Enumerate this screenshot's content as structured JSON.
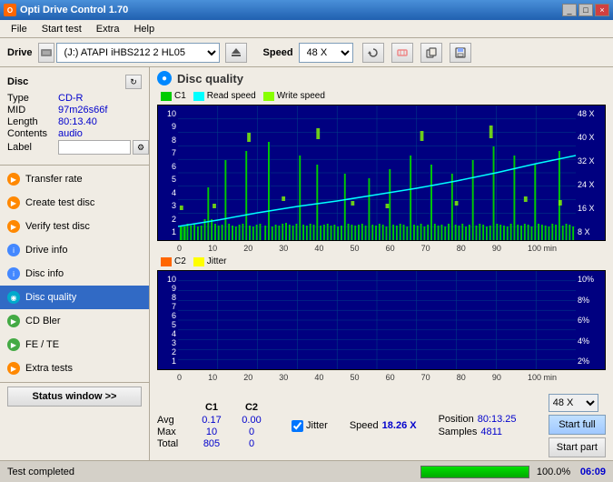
{
  "titlebar": {
    "title": "Opti Drive Control 1.70",
    "icon": "O",
    "buttons": [
      "_",
      "□",
      "×"
    ]
  },
  "menubar": {
    "items": [
      "File",
      "Start test",
      "Extra",
      "Help"
    ]
  },
  "drivebar": {
    "drive_label": "Drive",
    "drive_value": "(J:)  ATAPI iHBS212  2 HL05",
    "speed_label": "Speed",
    "speed_value": "48 X"
  },
  "disc": {
    "title": "Disc",
    "type_label": "Type",
    "type_value": "CD-R",
    "mid_label": "MID",
    "mid_value": "97m26s66f",
    "length_label": "Length",
    "length_value": "80:13.40",
    "contents_label": "Contents",
    "contents_value": "audio",
    "label_label": "Label",
    "label_value": ""
  },
  "sidebar": {
    "items": [
      {
        "id": "transfer-rate",
        "label": "Transfer rate",
        "icon_color": "orange"
      },
      {
        "id": "create-test-disc",
        "label": "Create test disc",
        "icon_color": "orange"
      },
      {
        "id": "verify-test-disc",
        "label": "Verify test disc",
        "icon_color": "orange"
      },
      {
        "id": "drive-info",
        "label": "Drive info",
        "icon_color": "blue"
      },
      {
        "id": "disc-info",
        "label": "Disc info",
        "icon_color": "blue"
      },
      {
        "id": "disc-quality",
        "label": "Disc quality",
        "icon_color": "cyan",
        "active": true
      },
      {
        "id": "cd-bler",
        "label": "CD Bler",
        "icon_color": "green"
      },
      {
        "id": "fe-te",
        "label": "FE / TE",
        "icon_color": "green"
      },
      {
        "id": "extra-tests",
        "label": "Extra tests",
        "icon_color": "orange"
      }
    ],
    "status_btn": "Status window >>"
  },
  "disc_quality": {
    "title": "Disc quality",
    "legend": [
      {
        "label": "C1",
        "color": "#00cc00"
      },
      {
        "label": "Read speed",
        "color": "#00ffff"
      },
      {
        "label": "Write speed",
        "color": "#88ff00"
      }
    ],
    "chart1": {
      "y_max": 10,
      "y_label_right": [
        "48 X",
        "40 X",
        "32 X",
        "24 X",
        "16 X",
        "8 X"
      ],
      "x_labels": [
        "0",
        "10",
        "20",
        "30",
        "40",
        "50",
        "60",
        "70",
        "80",
        "90",
        "100 min"
      ]
    },
    "chart2": {
      "legend": [
        {
          "label": "C2",
          "color": "#ff6600"
        },
        {
          "label": "Jitter",
          "color": "#ffff00"
        }
      ],
      "y_max": 10,
      "y_label_right": [
        "10%",
        "8%",
        "6%",
        "4%",
        "2%"
      ],
      "x_labels": [
        "0",
        "10",
        "20",
        "30",
        "40",
        "50",
        "60",
        "70",
        "80",
        "90",
        "100 min"
      ]
    },
    "stats": {
      "col_headers": [
        "",
        "C1",
        "C2"
      ],
      "avg_label": "Avg",
      "avg_c1": "0.17",
      "avg_c2": "0.00",
      "max_label": "Max",
      "max_c1": "10",
      "max_c2": "0",
      "total_label": "Total",
      "total_c1": "805",
      "total_c2": "0",
      "jitter_label": "Jitter",
      "speed_label": "Speed",
      "speed_value": "18.26 X",
      "position_label": "Position",
      "position_value": "80:13.25",
      "samples_label": "Samples",
      "samples_value": "4811",
      "speed_select": "48 X",
      "btn_start_full": "Start full",
      "btn_start_part": "Start part"
    }
  },
  "statusbar": {
    "text": "Test completed",
    "progress": 100,
    "percent": "100.0%",
    "time": "06:09"
  }
}
